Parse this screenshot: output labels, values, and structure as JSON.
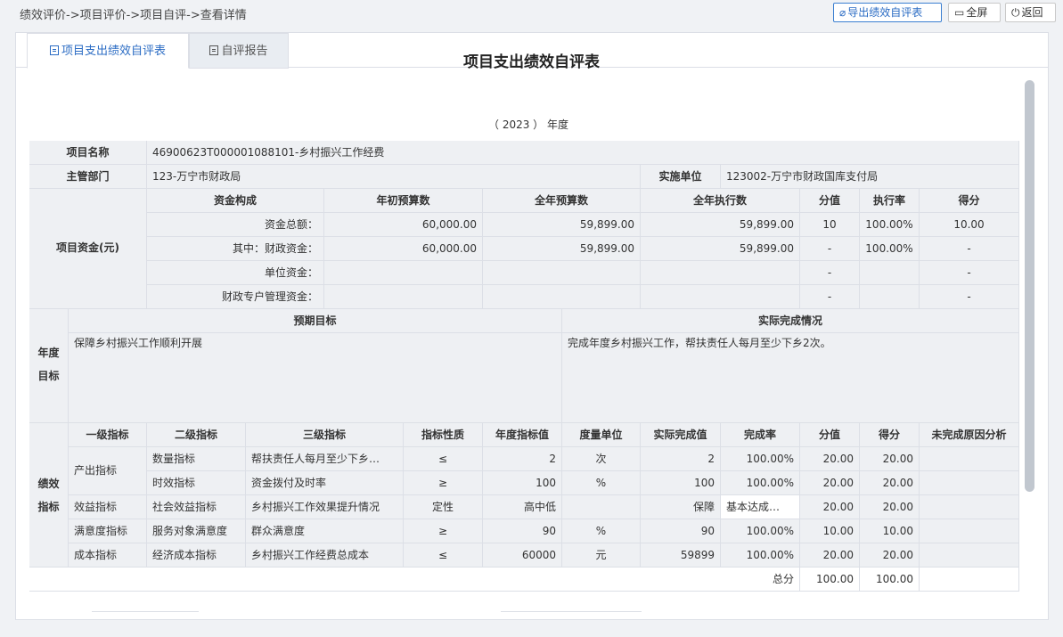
{
  "breadcrumb": "绩效评价->项目评价->项目自评->查看详情",
  "toolbar": {
    "export_label": "导出绩效自评表",
    "fullscreen_label": "全屏",
    "back_label": "返回"
  },
  "tabs": [
    {
      "label": "项目支出绩效自评表"
    },
    {
      "label": "自评报告"
    }
  ],
  "form": {
    "title": "项目支出绩效自评表",
    "year_text": "（ 2023 ） 年度",
    "project_name_label": "项目名称",
    "project_name": "46900623T000001088101-乡村振兴工作经费",
    "dept_label": "主管部门",
    "dept": "123-万宁市财政局",
    "impl_label": "实施单位",
    "impl": "123002-万宁市财政国库支付局",
    "fund_label": "项目资金(元)",
    "fund_headers": [
      "资金构成",
      "年初预算数",
      "全年预算数",
      "全年执行数",
      "分值",
      "执行率",
      "得分"
    ],
    "fund_rows": [
      [
        "资金总额：",
        "60,000.00",
        "59,899.00",
        "59,899.00",
        "10",
        "100.00%",
        "10.00"
      ],
      [
        "其中：财政资金：",
        "60,000.00",
        "59,899.00",
        "59,899.00",
        "-",
        "100.00%",
        "-"
      ],
      [
        "单位资金：",
        "",
        "",
        "",
        "-",
        "",
        "-"
      ],
      [
        "财政专户管理资金：",
        "",
        "",
        "",
        "-",
        "",
        "-"
      ]
    ],
    "annual_label": "年度目标",
    "annual_label_l1": "年度",
    "annual_label_l2": "目标",
    "expected_header": "预期目标",
    "actual_header": "实际完成情况",
    "expected_text": "保障乡村振兴工作顺利开展",
    "actual_text": "完成年度乡村振兴工作，帮扶责任人每月至少下乡2次。",
    "perf_label_l1": "绩效",
    "perf_label_l2": "指标",
    "ind_headers": [
      "一级指标",
      "二级指标",
      "三级指标",
      "指标性质",
      "年度指标值",
      "度量单位",
      "实际完成值",
      "完成率",
      "分值",
      "得分",
      "未完成原因分析"
    ],
    "ind_rows": [
      [
        "产出指标",
        "数量指标",
        "帮扶责任人每月至少下乡…",
        "≤",
        "2",
        "次",
        "2",
        "100.00%",
        "20.00",
        "20.00",
        ""
      ],
      [
        "",
        "时效指标",
        "资金拨付及时率",
        "≥",
        "100",
        "%",
        "100",
        "100.00%",
        "20.00",
        "20.00",
        ""
      ],
      [
        "效益指标",
        "社会效益指标",
        "乡村振兴工作效果提升情况",
        "定性",
        "高中低",
        "",
        "保障",
        "基本达成…",
        "20.00",
        "20.00",
        ""
      ],
      [
        "满意度指标",
        "服务对象满意度",
        "群众满意度",
        "≥",
        "90",
        "%",
        "90",
        "100.00%",
        "10.00",
        "10.00",
        ""
      ],
      [
        "成本指标",
        "经济成本指标",
        "乡村振兴工作经费总成本",
        "≤",
        "60000",
        "元",
        "59899",
        "100.00%",
        "20.00",
        "20.00",
        ""
      ]
    ],
    "total_label": "总分",
    "total_score": "100.00",
    "total_got": "100.00"
  }
}
